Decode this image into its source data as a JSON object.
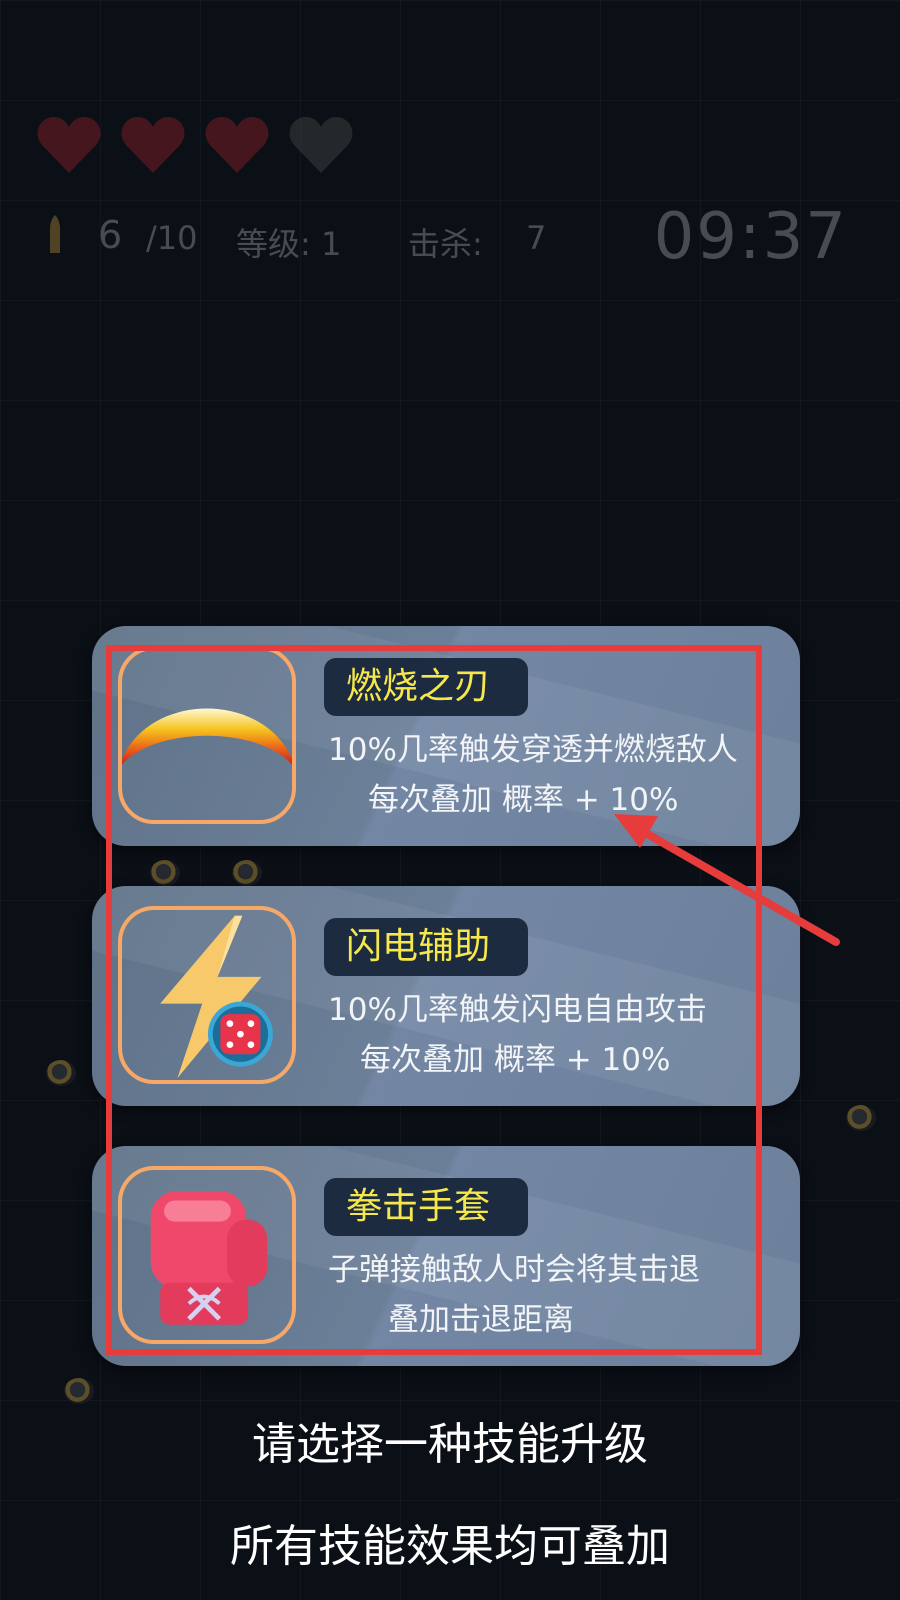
{
  "hud": {
    "hearts_total": 4,
    "hearts_full": 3,
    "ammo_current": "6",
    "ammo_max": "/10",
    "level_label": "等级: 1",
    "kills_label": "击杀:",
    "kills_value": "7",
    "timer": "09:37"
  },
  "skills": [
    {
      "name": "燃烧之刃",
      "desc_line1": "10%几率触发穿透并燃烧敌人",
      "desc_line2": "每次叠加 概率 + 10%",
      "icon": "flame-blade-icon"
    },
    {
      "name": "闪电辅助",
      "desc_line1": "10%几率触发闪电自由攻击",
      "desc_line2": "每次叠加 概率 + 10%",
      "icon": "lightning-dice-icon"
    },
    {
      "name": "拳击手套",
      "desc_line1": "子弹接触敌人时会将其击退",
      "desc_line2": "叠加击退距离",
      "icon": "boxing-glove-icon"
    }
  ],
  "prompt": {
    "line1": "请选择一种技能升级",
    "line2": "所有技能效果均可叠加"
  },
  "colors": {
    "highlight": "#e63c3c",
    "title_text": "#f6e84a",
    "icon_border": "#f5a868"
  }
}
